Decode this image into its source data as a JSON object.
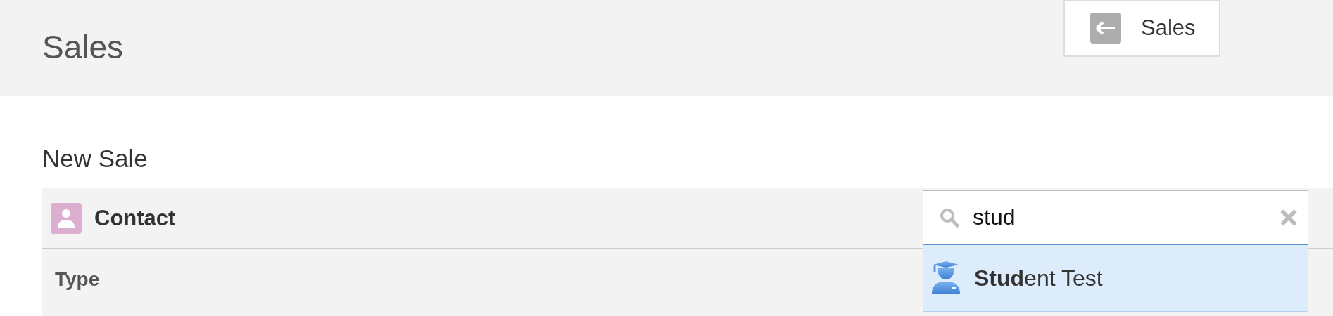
{
  "header": {
    "title": "Sales",
    "back_button": "Sales"
  },
  "form": {
    "title": "New Sale",
    "contact": {
      "label": "Contact",
      "search": {
        "value": "stud"
      },
      "results": [
        {
          "text": "**Stud**ent Test",
          "selected": true
        }
      ]
    },
    "fields": [
      {
        "label": "Type"
      }
    ]
  }
}
